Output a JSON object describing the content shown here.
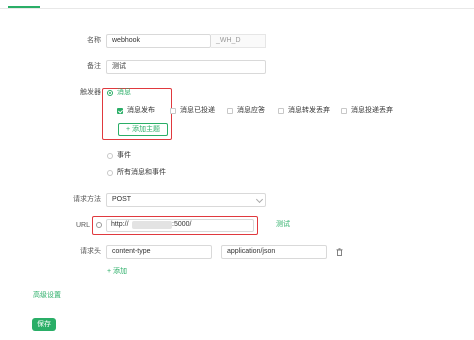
{
  "form": {
    "name": {
      "label": "名称",
      "value": "webhook",
      "suffix": "_WH_D"
    },
    "remark": {
      "label": "备注",
      "value": "测试"
    },
    "trigger": {
      "label": "触发器",
      "message_option": "消息",
      "topics": [
        "消息发布",
        "消息已投递",
        "消息应答",
        "消息转发丢弃",
        "消息投递丢弃"
      ],
      "topics_checked": [
        true,
        false,
        false,
        false,
        false
      ],
      "add_topic": "+ 添加主题",
      "event_option": "事件",
      "all_option": "所有消息和事件"
    },
    "method": {
      "label": "请求方法",
      "value": "POST"
    },
    "url": {
      "label": "URL",
      "prefix": "http://",
      "suffix": ":5000/",
      "test_link": "测试"
    },
    "headers": {
      "label": "请求头",
      "key": "content-type",
      "value": "application/json",
      "add": "+ 添加"
    },
    "advanced": "高级设置",
    "save": "保存"
  },
  "colors": {
    "accent": "#2aae67",
    "highlight": "#e0393e"
  }
}
